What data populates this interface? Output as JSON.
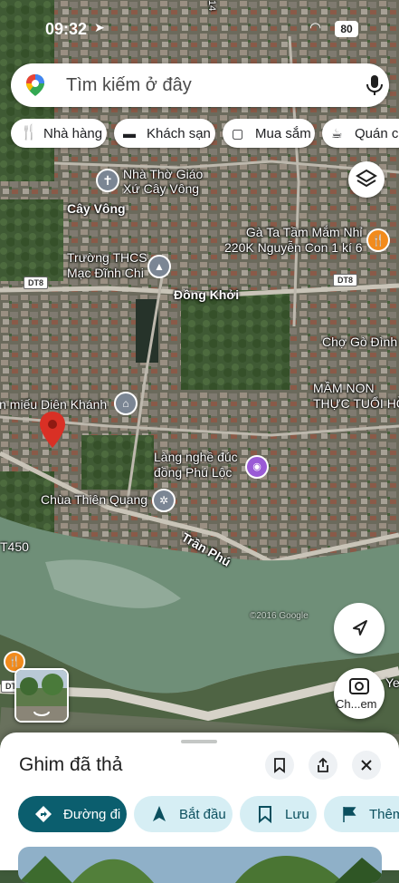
{
  "status_bar": {
    "time": "09:32",
    "battery": "80"
  },
  "search": {
    "placeholder": "Tìm kiếm ở đây"
  },
  "chips": [
    {
      "label": "Nhà hàng",
      "icon": "fork-knife-icon"
    },
    {
      "label": "Khách sạn",
      "icon": "bed-icon"
    },
    {
      "label": "Mua sắm",
      "icon": "shopping-bag-icon"
    },
    {
      "label": "Quán cà",
      "icon": "coffee-cup-icon"
    }
  ],
  "map_labels": {
    "church": "Nhà Thờ Giáo\nXứ Cây Vông",
    "cay_vong": "Cây Vông",
    "school": "Trường THCS\nMạc Đĩnh Chi",
    "dong_khoi": "Đồng Khởi",
    "restaurant": "Gà Ta Tầm Mắm Nhỉ\n220K Nguyễn Con 1 kí 6",
    "market": "Chợ Gò Đình",
    "kindergarten": "MẦM NON\nTHỰC TUỔI HỒ",
    "temple": "Văn miếu Diên Khánh",
    "craft_village": "Làng nghề đúc\nđồng Phú Lộc",
    "pagoda": "Chùa Thiên Quang",
    "tran_phu": "Trần Phú",
    "route_450": "T450",
    "dt8_a": "DT8",
    "dt8_b": "DT8",
    "dt_c": "DT",
    "watermark": "©2016 Google",
    "ye": "Ye",
    "s14": "14"
  },
  "street_view_label": "Ch...em",
  "sheet": {
    "title": "Ghim đã thả",
    "actions": [
      {
        "label": "Đường đi",
        "icon": "directions-icon"
      },
      {
        "label": "Bắt đầu",
        "icon": "navigation-arrow-icon"
      },
      {
        "label": "Lưu",
        "icon": "bookmark-icon"
      },
      {
        "label": "Thêm",
        "icon": "flag-icon"
      }
    ]
  },
  "colors": {
    "brand": "#0b5e6e",
    "secondary": "#d6eef4",
    "river": "#6f8f78",
    "pin": "#d93025",
    "poi_orange": "#f28b1c",
    "poi_purple": "#9a5bd6"
  }
}
